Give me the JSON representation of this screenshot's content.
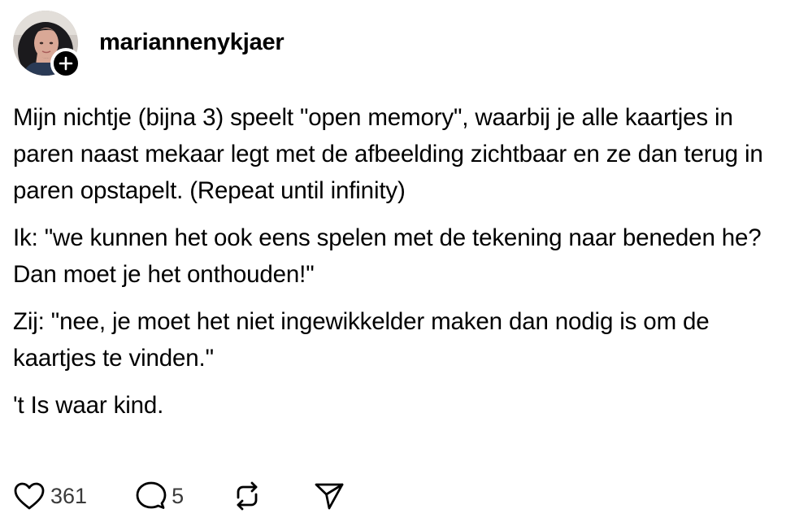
{
  "author": {
    "username": "mariannenykjaer"
  },
  "post": {
    "paragraphs": [
      "Mijn nichtje (bijna 3) speelt \"open memory\", waarbij je alle kaartjes in paren naast mekaar legt met de afbeelding zichtbaar en ze dan terug in paren opstapelt. (Repeat until infinity)",
      "Ik: \"we kunnen het ook eens spelen met de tekening naar beneden he? Dan moet je het onthouden!\"",
      "Zij: \"nee, je moet het niet ingewikkelder maken dan nodig is om de kaartjes te vinden.\"",
      "'t Is waar kind."
    ]
  },
  "actions": {
    "like": {
      "icon": "heart-icon",
      "count": "361"
    },
    "reply": {
      "icon": "comment-icon",
      "count": "5"
    },
    "repost": {
      "icon": "repost-icon"
    },
    "share": {
      "icon": "send-icon"
    }
  },
  "colors": {
    "text": "#000000",
    "count_text": "#3a3a3a",
    "background": "#ffffff"
  }
}
